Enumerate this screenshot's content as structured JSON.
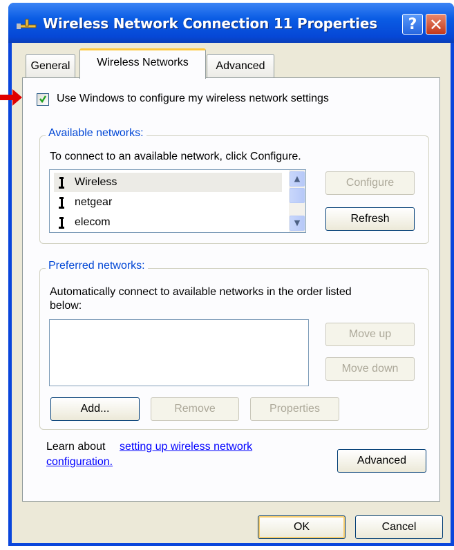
{
  "window": {
    "title": "Wireless Network Connection 11 Properties",
    "help_label": "?",
    "close_label": "✕"
  },
  "tabs": [
    {
      "label": "General"
    },
    {
      "label": "Wireless Networks"
    },
    {
      "label": "Advanced"
    }
  ],
  "use_windows_checkbox": {
    "label": "Use Windows to configure my wireless network settings",
    "checked": true
  },
  "available": {
    "legend": "Available networks:",
    "instruction": "To connect to an available network, click Configure.",
    "networks": [
      "Wireless",
      "netgear",
      "elecom"
    ],
    "selected": "Wireless",
    "configure_label": "Configure",
    "refresh_label": "Refresh"
  },
  "preferred": {
    "legend": "Preferred networks:",
    "instruction_line1": "Automatically connect to available networks in the order listed",
    "instruction_line2": "below:",
    "move_up_label": "Move up",
    "move_down_label": "Move down",
    "add_label": "Add...",
    "remove_label": "Remove",
    "properties_label": "Properties"
  },
  "learn": {
    "prefix": "Learn about",
    "link_line1": "setting up wireless network",
    "link_line2": "configuration."
  },
  "advanced_label": "Advanced",
  "ok_label": "OK",
  "cancel_label": "Cancel",
  "icons": {
    "title": "network-connection-icon",
    "network": "access-point-icon",
    "pointer": "red-arrow-icon"
  },
  "colors": {
    "title_bar": "#0a5ce4",
    "legend": "#0046d5",
    "link": "#0000ff",
    "pointer": "#e00000",
    "dialog_bg": "#ece9d8"
  }
}
